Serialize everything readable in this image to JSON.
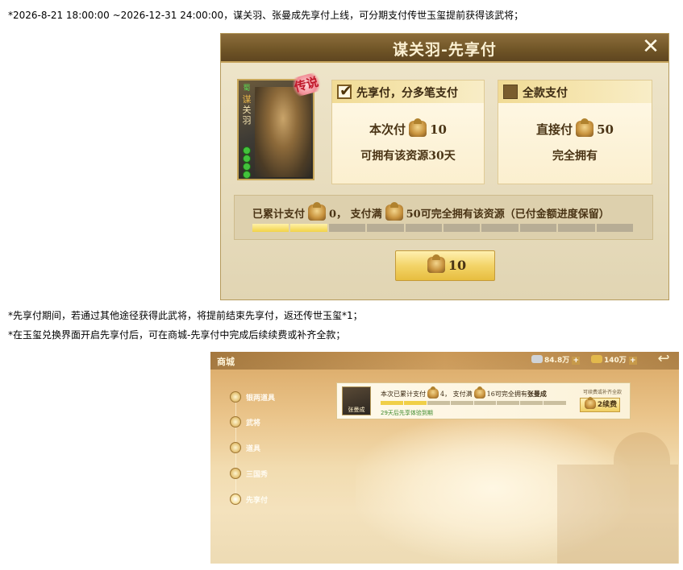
{
  "intro_text": "*2026-8-21 18:00:00 ~2026-12-31 24:00:00，谋关羽、张曼成先享付上线，可分期支付传世玉玺提前获得该武将；",
  "dialog": {
    "title": "谋关羽-先享付",
    "close_symbol": "✕",
    "card": {
      "faction": "蜀",
      "name_chars": [
        "谋",
        "关",
        "羽"
      ],
      "rarity_badge": "传说"
    },
    "option_installment": {
      "title": "先享付，分多笔支付",
      "checked": true,
      "price_label": "本次付",
      "price_value": "10",
      "sub_text": "可拥有该资源30天"
    },
    "option_full": {
      "title": "全款支付",
      "checked": false,
      "price_label": "直接付",
      "price_value": "50",
      "sub_text": "完全拥有"
    },
    "progress": {
      "prefix": "已累计支付",
      "paid": "0，",
      "middle": "支付满",
      "total": "50",
      "suffix": "可完全拥有该资源（已付金额进度保留）",
      "segments_total": 10,
      "segments_filled": 2
    },
    "pay_button_value": "10"
  },
  "note1": "*先享付期间，若通过其他途径获得此武将，将提前结束先享付，返还传世玉玺*1；",
  "note2": "*在玉玺兑换界面开启先享付后，可在商城-先享付中完成后续续费或补齐全款；",
  "shop": {
    "title": "商城",
    "currency_silver": "84.8万",
    "currency_gold": "140万",
    "back_symbol": "↩",
    "nav": [
      "银两道具",
      "武将",
      "道具",
      "三国秀",
      "先享付"
    ],
    "active_nav": "先享付",
    "entry": {
      "avatar_name": "张曼成",
      "text_prefix": "本次已累计支付",
      "paid": "4，",
      "text_middle": "支付满",
      "total": "16",
      "text_suffix": "可完全拥有",
      "general_name": "张曼成",
      "days_text": "29天后先享体验到期",
      "hint": "可续费或补齐全款",
      "renew_value": "2",
      "renew_label": "续费",
      "segments_total": 8,
      "segments_filled": 2
    }
  },
  "colors": {
    "dialog_header": "#6f5426",
    "accent_gold": "#f2d247",
    "text_brown": "#4a3415",
    "days_green": "#3c8a2c"
  }
}
